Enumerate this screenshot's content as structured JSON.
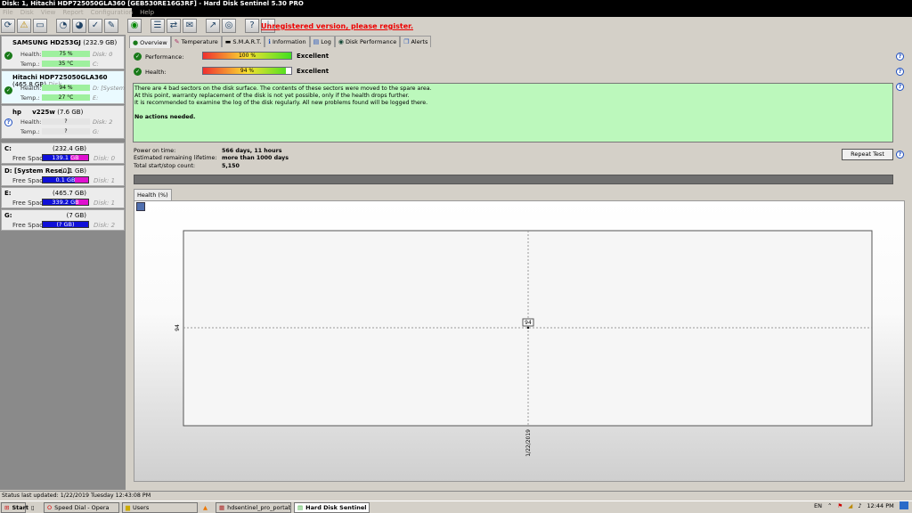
{
  "window": {
    "title": "Disk: 1, Hitachi HDP725050GLA360 [GEB530RE16G3RF]  -  Hard Disk Sentinel 5.30 PRO"
  },
  "menu": [
    "File",
    "Disk",
    "View",
    "Report",
    "Configuration",
    "Help"
  ],
  "register_link": "Unregistered version, please register.",
  "disks": [
    {
      "name": "SAMSUNG HD253GJ",
      "size": "(232.9 GB)",
      "health": "75 %",
      "health_pct": 75,
      "temp": "35 °C",
      "sub1": "Disk: 0",
      "sub2": "C:",
      "status": "ok"
    },
    {
      "name": "Hitachi HDP725050GLA360",
      "size": "(465.8 GB)",
      "health": "94 %",
      "health_pct": 94,
      "temp": "27 °C",
      "sub1": "D: [System Re",
      "sub2": "E:",
      "status": "ok",
      "selected": true,
      "tail": "Disk"
    },
    {
      "name": "hp     v225w",
      "size": "(7.6 GB)",
      "health": "?",
      "temp": "?",
      "sub1": "Disk: 2",
      "sub2": "G:",
      "status": "unknown"
    }
  ],
  "labels": {
    "health": "Health:",
    "temp": "Temp.:",
    "free_space": "Free Space"
  },
  "volumes": [
    {
      "name": "C:",
      "size": "(232.4 GB)",
      "free": "139.1 GB",
      "free_pct": 60,
      "disk": "Disk: 0"
    },
    {
      "name": "D: [System Rese..]",
      "size": "(0.1 GB)",
      "free": "0.1 GB",
      "free_pct": 70,
      "disk": "Disk: 1"
    },
    {
      "name": "E:",
      "size": "(465.7 GB)",
      "free": "339.2 GB",
      "free_pct": 73,
      "disk": "Disk: 1"
    },
    {
      "name": "G:",
      "size": "(7 GB)",
      "free": "(? GB)",
      "free_pct": 100,
      "disk": "Disk: 2"
    }
  ],
  "tabs": [
    "Overview",
    "Temperature",
    "S.M.A.R.T.",
    "Information",
    "Log",
    "Disk Performance",
    "Alerts"
  ],
  "overview": {
    "performance": {
      "label": "Performance:",
      "value": "100 %",
      "pct": 100,
      "rating": "Excellent"
    },
    "health": {
      "label": "Health:",
      "value": "94 %",
      "pct": 94,
      "rating": "Excellent"
    },
    "message": [
      "There are 4 bad sectors on the disk surface. The contents of these sectors were moved to the spare area.",
      "At this point, warranty replacement of the disk is not yet possible, only if the health drops further.",
      "It is recommended to examine the log of the disk regularly. All new problems found will be logged there."
    ],
    "message_bold": "No actions needed.",
    "info": [
      {
        "label": "Power on time:",
        "value": "566 days, 11 hours"
      },
      {
        "label": "Estimated remaining lifetime:",
        "value": "more than 1000 days"
      },
      {
        "label": "Total start/stop count:",
        "value": "5,150"
      }
    ],
    "repeat_test": "Repeat Test"
  },
  "chart_data": {
    "type": "line",
    "tab": "Health (%)",
    "x": [
      "1/22/2019"
    ],
    "values": [
      94
    ],
    "data_labels": [
      "94"
    ],
    "ytick": "94",
    "xtick": "1/22/2019"
  },
  "status_bar": "Status last updated: 1/22/2019 Tuesday 12:43:08 PM",
  "taskbar": {
    "start": "Start",
    "items": [
      "Speed Dial - Opera",
      "Users",
      "hdsentinel_pro_portable...",
      "Hard Disk Sentinel"
    ],
    "lang": "EN",
    "clock": "12:44 PM"
  }
}
